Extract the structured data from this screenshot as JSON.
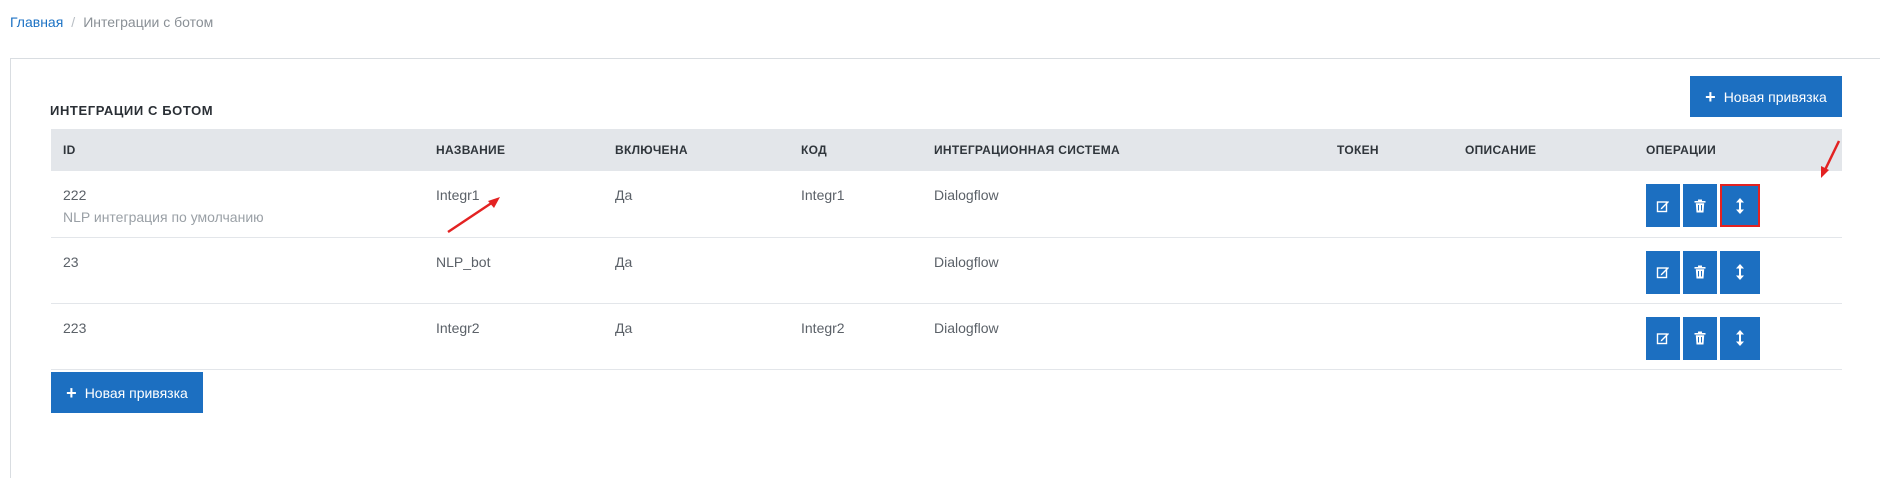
{
  "breadcrumb": {
    "home": "Главная",
    "separator": "/",
    "current": "Интеграции с ботом"
  },
  "panel": {
    "title": "ИНТЕГРАЦИИ С БОТОМ"
  },
  "actions": {
    "new_binding_label": "Новая привязка"
  },
  "table": {
    "columns": [
      "ID",
      "НАЗВАНИЕ",
      "ВКЛЮЧЕНА",
      "КОД",
      "ИНТЕГРАЦИОННАЯ СИСТЕМА",
      "ТОКЕН",
      "ОПИСАНИЕ",
      "ОПЕРАЦИИ"
    ],
    "rows": [
      {
        "id": "222",
        "id_note": "NLP интеграция по умолчанию",
        "name": "Integr1",
        "enabled": "Да",
        "code": "Integr1",
        "system": "Dialogflow",
        "token": "",
        "description": ""
      },
      {
        "id": "23",
        "id_note": "",
        "name": "NLP_bot",
        "enabled": "Да",
        "code": "",
        "system": "Dialogflow",
        "token": "",
        "description": ""
      },
      {
        "id": "223",
        "id_note": "",
        "name": "Integr2",
        "enabled": "Да",
        "code": "Integr2",
        "system": "Dialogflow",
        "token": "",
        "description": ""
      }
    ]
  },
  "icons": {
    "edit": "edit-icon",
    "delete": "trash-icon",
    "move": "vertical-arrows-icon",
    "add": "plus-icon"
  },
  "colors": {
    "accent": "#1c6fc1",
    "annotation": "#e32222",
    "header_bg": "#e3e6ea"
  }
}
